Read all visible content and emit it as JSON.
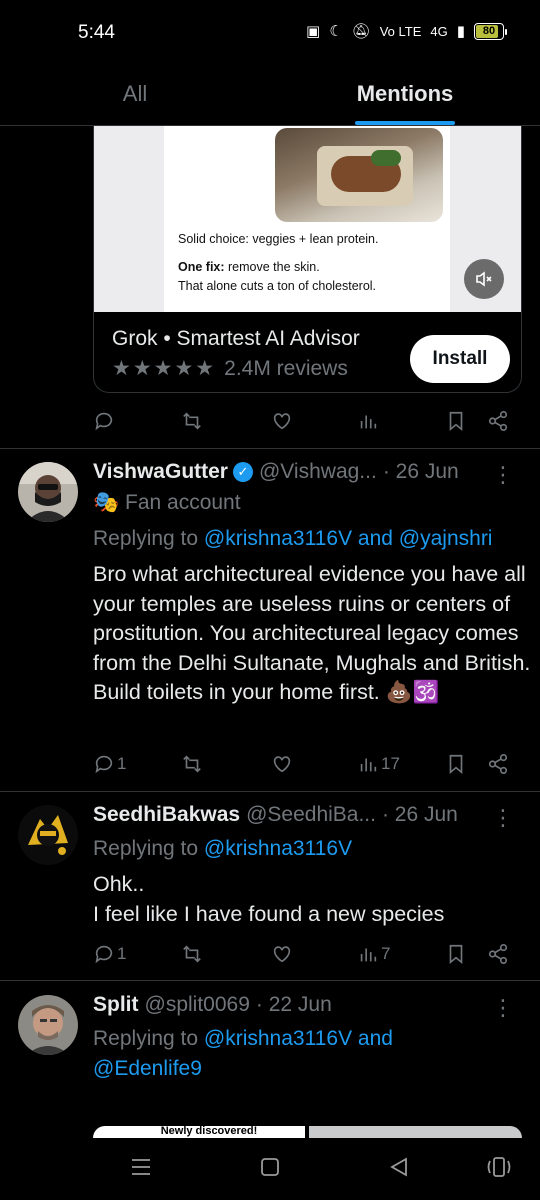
{
  "status_bar": {
    "time": "5:44",
    "network": "4G",
    "volte": "Vo LTE",
    "battery": "80",
    "battery_level": 0.8
  },
  "tabs": [
    {
      "label": "All",
      "active": false
    },
    {
      "label": "Mentions",
      "active": true
    }
  ],
  "ad": {
    "line1": "Solid choice: veggies + lean protein.",
    "fix_label": "One fix:",
    "fix_text": " remove the skin.",
    "line3": "That alone cuts a ton of cholesterol.",
    "app_name": "Grok • Smartest AI Advisor",
    "stars": "★★★★★",
    "reviews": "2.4M reviews",
    "install_label": "Install"
  },
  "tweets": [
    {
      "name": "VishwaGutter",
      "verified": true,
      "handle": "@Vishwag...",
      "date": "· 26 Jun",
      "badge_icon": "🎭",
      "badge_label": "Fan account",
      "replying_prefix": "Replying to ",
      "replying_to": "@krishna3116V and @yajnshri",
      "text": "Bro what architectureal evidence you have all your temples are useless ruins or centers of prostitution. You architectureal legacy comes from the Delhi Sultanate, Mughals and British. Build toilets in your home first. 💩🕉️",
      "replies": "1",
      "views": "17"
    },
    {
      "name": "SeedhiBakwas",
      "handle": "@SeedhiBa...",
      "date": "· 26 Jun",
      "replying_prefix": "Replying to ",
      "replying_to": "@krishna3116V",
      "text_line1": "Ohk..",
      "text_line2": "I feel like I have found a new species",
      "replies": "1",
      "views": "7"
    },
    {
      "name": "Split",
      "handle": "@split0069",
      "date": "· 22 Jun",
      "replying_prefix": "Replying to ",
      "replying_to_line1": "@krishna3116V and",
      "replying_to_line2": "@Edenlife9"
    }
  ],
  "preview_text": "Newly discovered!",
  "colors": {
    "accent": "#1d9bf0",
    "muted": "#71767b",
    "text": "#e7e9ea",
    "divider": "#2f3336"
  }
}
